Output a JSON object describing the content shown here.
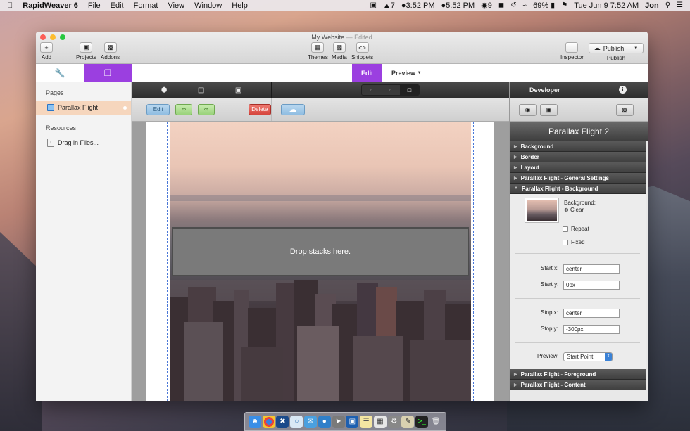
{
  "menubar": {
    "app_name": "RapidWeaver 6",
    "menus": [
      "File",
      "Edit",
      "Format",
      "View",
      "Window",
      "Help"
    ],
    "status": {
      "adobe_count": "7",
      "time_1": "3:52 PM",
      "time_2": "5:52 PM",
      "count_9": "9",
      "battery": "69%",
      "datetime": "Tue Jun 9  7:52 AM",
      "user": "Jon"
    }
  },
  "window": {
    "title": "My Website",
    "title_state": "— Edited",
    "toolbar": {
      "add": "Add",
      "projects": "Projects",
      "addons": "Addons",
      "themes": "Themes",
      "media": "Media",
      "snippets": "Snippets",
      "inspector": "Inspector",
      "publish_button": "Publish",
      "publish_label": "Publish"
    },
    "mode_tabs": {
      "edit": "Edit",
      "preview": "Preview"
    }
  },
  "sidebar": {
    "pages_header": "Pages",
    "page_item": "Parallax Flight",
    "resources_header": "Resources",
    "drag_item": "Drag in Files..."
  },
  "editor": {
    "edit_btn": "Edit",
    "delete_btn": "Delete",
    "drop_text": "Drop stacks here."
  },
  "inspector": {
    "header": "Developer",
    "title": "Parallax Flight 2",
    "sections_top": [
      "Background",
      "Border",
      "Layout",
      "Parallax Flight - General Settings",
      "Parallax Flight - Background"
    ],
    "sections_bottom": [
      "Parallax Flight - Foreground",
      "Parallax Flight - Content"
    ],
    "background_label": "Background:",
    "clear_label": "Clear",
    "repeat_label": "Repeat",
    "fixed_label": "Fixed",
    "start_x_label": "Start x:",
    "start_x_value": "center",
    "start_y_label": "Start y:",
    "start_y_value": "0px",
    "stop_x_label": "Stop x:",
    "stop_x_value": "center",
    "stop_y_label": "Stop y:",
    "stop_y_value": "-300px",
    "preview_label": "Preview:",
    "preview_value": "Start Point"
  },
  "colors": {
    "accent": "#9b3fe0",
    "delete": "#d6453c",
    "selected_row": "#f6d6bd"
  }
}
